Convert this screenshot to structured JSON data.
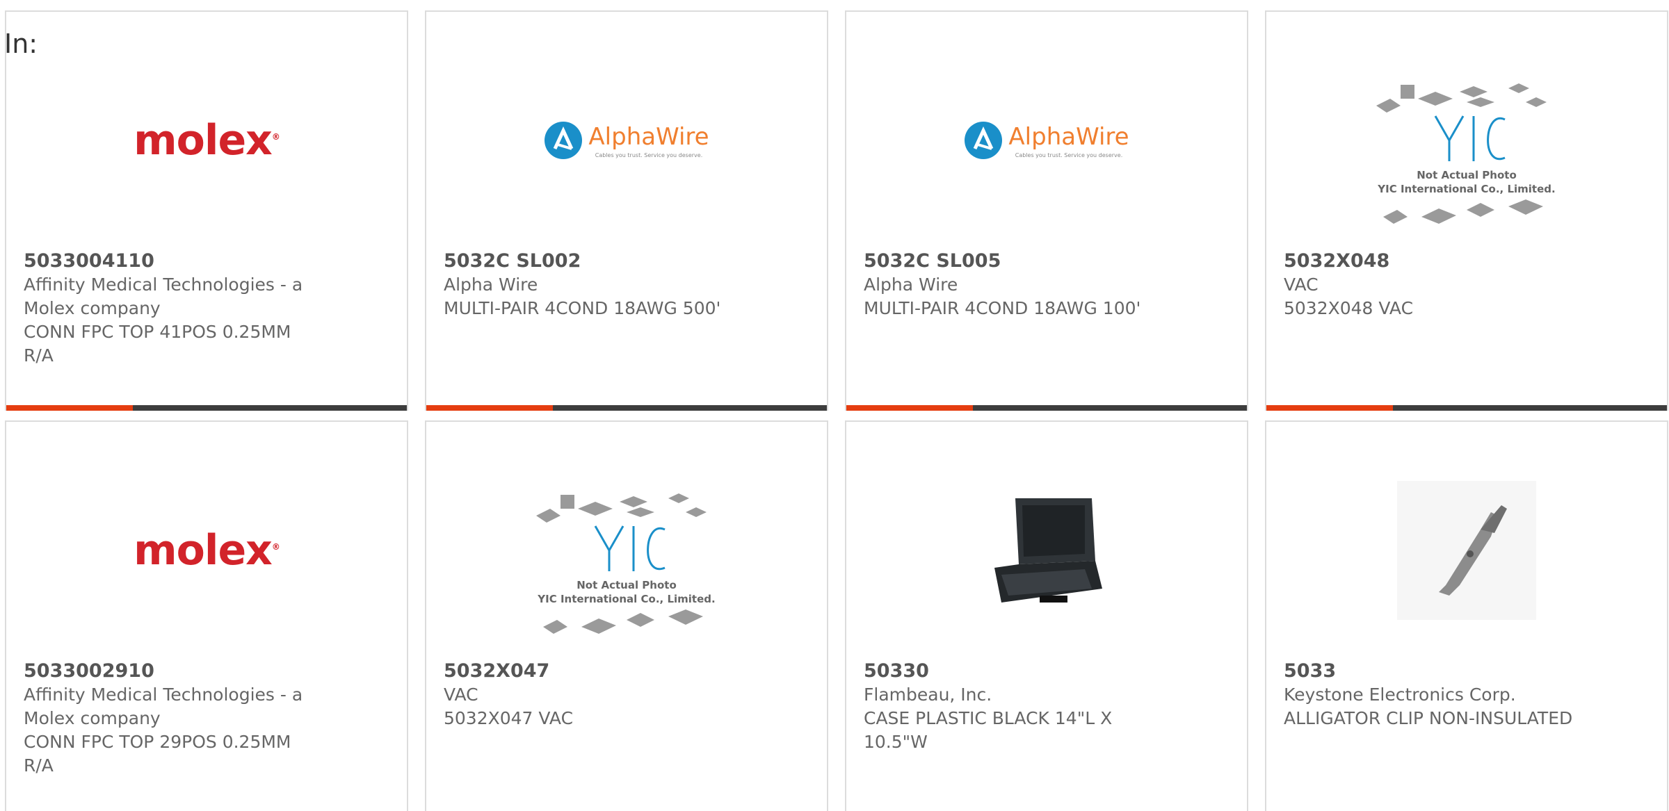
{
  "header": {
    "in_label": "In:"
  },
  "products": [
    {
      "part_number": "5033004110",
      "manufacturer": "Affinity Medical Technologies - a Molex company",
      "description": "CONN FPC TOP 41POS 0.25MM R/A",
      "image": "molex-logo"
    },
    {
      "part_number": "5032C SL002",
      "manufacturer": "Alpha Wire",
      "description": "MULTI-PAIR 4COND 18AWG 500'",
      "image": "alphawire-logo"
    },
    {
      "part_number": "5032C SL005",
      "manufacturer": "Alpha Wire",
      "description": "MULTI-PAIR 4COND 18AWG 100'",
      "image": "alphawire-logo"
    },
    {
      "part_number": "5032X048",
      "manufacturer": "VAC",
      "description": "5032X048 VAC",
      "image": "yic-placeholder"
    },
    {
      "part_number": "5033002910",
      "manufacturer": "Affinity Medical Technologies - a Molex company",
      "description": "CONN FPC TOP 29POS 0.25MM R/A",
      "image": "molex-logo"
    },
    {
      "part_number": "5032X047",
      "manufacturer": "VAC",
      "description": "5032X047 VAC",
      "image": "yic-placeholder"
    },
    {
      "part_number": "50330",
      "manufacturer": "Flambeau, Inc.",
      "description": "CASE PLASTIC BLACK 14\"L X 10.5\"W",
      "image": "black-case-photo"
    },
    {
      "part_number": "5033",
      "manufacturer": "Keystone Electronics Corp.",
      "description": "ALLIGATOR CLIP NON-INSULATED",
      "image": "alligator-clip-photo"
    }
  ],
  "logos": {
    "molex": "molex",
    "alphawire": "AlphaWire",
    "alphawire_tagline": "Cables you trust. Service you deserve.",
    "yic_line1": "Not Actual Photo",
    "yic_line2": "YIC International Co., Limited."
  },
  "colors": {
    "accent_orange": "#e53d10",
    "accent_dark": "#3d3d3d",
    "molex_red": "#d2232a",
    "alphawire_blue": "#1a8fc9",
    "alphawire_orange": "#f07f2f"
  }
}
